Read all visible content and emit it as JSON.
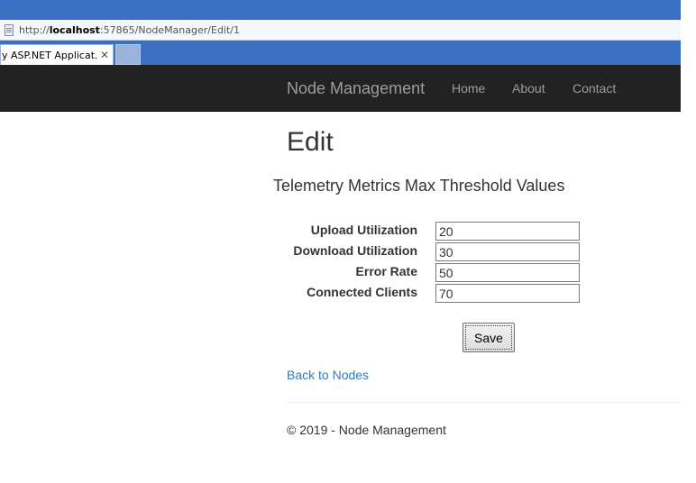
{
  "browser": {
    "address": {
      "prefix": "http://",
      "host": "localhost",
      "suffix": ":57865/NodeManager/Edit/1"
    },
    "tab": {
      "title": "y ASP.NET Applicat...",
      "close_glyph": "✕"
    },
    "accent_color": "#3a6fc1"
  },
  "navbar": {
    "brand": "Node Management",
    "links": [
      "Home",
      "About",
      "Contact"
    ],
    "background": "#222222"
  },
  "main": {
    "title": "Edit",
    "section_title": "Telemetry Metrics Max Threshold Values",
    "fields": [
      {
        "label": "Upload Utilization",
        "value": "20"
      },
      {
        "label": "Download Utilization",
        "value": "30"
      },
      {
        "label": "Error Rate",
        "value": "50"
      },
      {
        "label": "Connected Clients",
        "value": "70"
      }
    ],
    "save_label": "Save",
    "back_link": "Back to Nodes",
    "link_color": "#337ab7"
  },
  "footer": {
    "text": "© 2019 - Node Management"
  }
}
